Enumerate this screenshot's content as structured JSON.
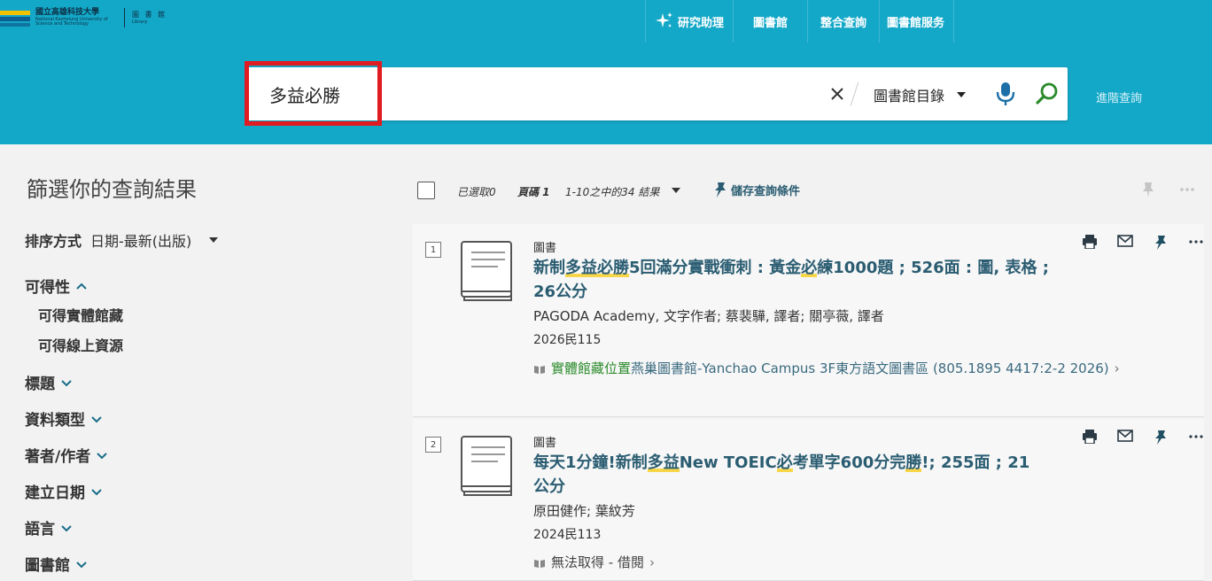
{
  "header": {
    "logo": {
      "name_cn": "國立高雄科技大學",
      "name_en": "National Kaohsiung University of Science and Technology",
      "library_cn": "圖 書 館",
      "library_en": "Library"
    },
    "nav": [
      {
        "label": "研究助理",
        "icon": "sparkle-icon"
      },
      {
        "label": "圖書館"
      },
      {
        "label": "整合查詢"
      },
      {
        "label": "圖書館服务"
      }
    ],
    "search": {
      "query": "多益必勝",
      "scope": "圖書館目錄",
      "advanced_label": "進階查詢"
    }
  },
  "sidebar": {
    "title": "篩選你的查詢結果",
    "sort_label": "排序方式",
    "sort_value": "日期-最新(出版)",
    "facets": [
      {
        "label": "可得性",
        "expanded": true,
        "options": [
          "可得實體館藏",
          "可得線上資源"
        ]
      },
      {
        "label": "標題"
      },
      {
        "label": "資料類型"
      },
      {
        "label": "著者/作者"
      },
      {
        "label": "建立日期"
      },
      {
        "label": "語言"
      },
      {
        "label": "圖書館"
      }
    ]
  },
  "toolbar": {
    "selected": "已選取0",
    "page": "頁碼 1",
    "range": "1-10之中的34 結果",
    "save_query": "儲存查詢條件"
  },
  "results": [
    {
      "num": "1",
      "type": "圖書",
      "title_parts": [
        {
          "t": "新制",
          "hl": false
        },
        {
          "t": "多益必勝",
          "hl": true
        },
        {
          "t": "5回滿分實戰衝刺 : 黃金",
          "hl": false
        },
        {
          "t": "必",
          "hl": true
        },
        {
          "t": "練1000題 ; 526面 : 圖, 表格 ; 26公分",
          "hl": false
        }
      ],
      "author": "PAGODA Academy, 文字作者; 蔡裴驊, 譯者; 關亭薇, 譯者",
      "date": "2026民115",
      "availability": {
        "status": "實體館藏位置",
        "location": "燕巢圖書館-Yanchao Campus   3F東方語文圖書區 (805.1895 4417:2-2 2026)"
      }
    },
    {
      "num": "2",
      "type": "圖書",
      "title_parts": [
        {
          "t": "每天1分鐘!新制",
          "hl": false
        },
        {
          "t": "多益",
          "hl": true
        },
        {
          "t": "New TOEIC",
          "hl": false
        },
        {
          "t": "必",
          "hl": true
        },
        {
          "t": "考單字600分完",
          "hl": false
        },
        {
          "t": "勝",
          "hl": true
        },
        {
          "t": "!; 255面 ; 21公分",
          "hl": false
        }
      ],
      "author": "原田健作; 葉紋芳",
      "date": "2024民113",
      "availability": {
        "status": "無法取得 - 借閱"
      }
    }
  ],
  "colors": {
    "header_bg": "#14a8c8",
    "highlight_box": "#e01b22",
    "title_color": "#2b5d72",
    "available_green": "#2a8a2a",
    "term_highlight": "#f7d64a"
  }
}
